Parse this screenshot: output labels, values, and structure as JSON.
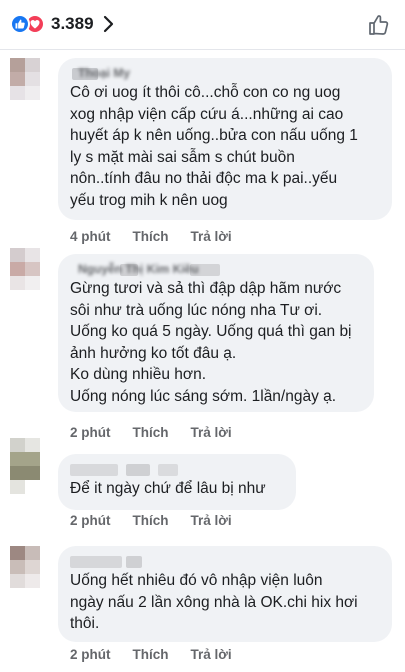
{
  "reactions": {
    "count": "3.389",
    "types": [
      "like-icon",
      "heart-icon"
    ],
    "colors": {
      "like": "#1877f2",
      "heart": "#f33e58"
    }
  },
  "comments": [
    {
      "author": "Thoại My",
      "text": "Cô ơi uog ít thôi cô...chỗ con co ng uog\nxog nhập viện cấp cứu á...những ai cao\nhuyết áp k nên uống..bửa con nấu uống 1\nly s mặt mài sai sẫm s chút buồn\nnôn..tính đâu no thải độc ma k pai..yếu\nyếu trog mih k nên uog",
      "time": "4 phút",
      "like": "Thích",
      "reply": "Trả lời"
    },
    {
      "author": "Nguyễn Thị Kim Kiều",
      "text": "Gừng tươi và sả thì đập dập hãm nước\nsôi như trà uống lúc nóng nha Tư ơi.\nUống ko quá 5 ngày. Uống quá thì gan bị\nảnh hưởng ko tốt đâu ạ.\nKo dùng nhiều hơn.\nUống nóng lúc sáng sớm. 1lần/ngày ạ.",
      "time": "2 phút",
      "like": "Thích",
      "reply": "Trả lời"
    },
    {
      "author": "",
      "text": "Để it ngày chứ để lâu bị như",
      "time": "2 phút",
      "like": "Thích",
      "reply": "Trả lời"
    },
    {
      "author": "",
      "text": "Uống hết nhiêu đó vô nhập viện luôn\nngày nấu 2 lần xông nhà là OK.chi hix hơi\nthôi.",
      "time": "2 phút",
      "like": "Thích",
      "reply": "Trả lời"
    }
  ]
}
